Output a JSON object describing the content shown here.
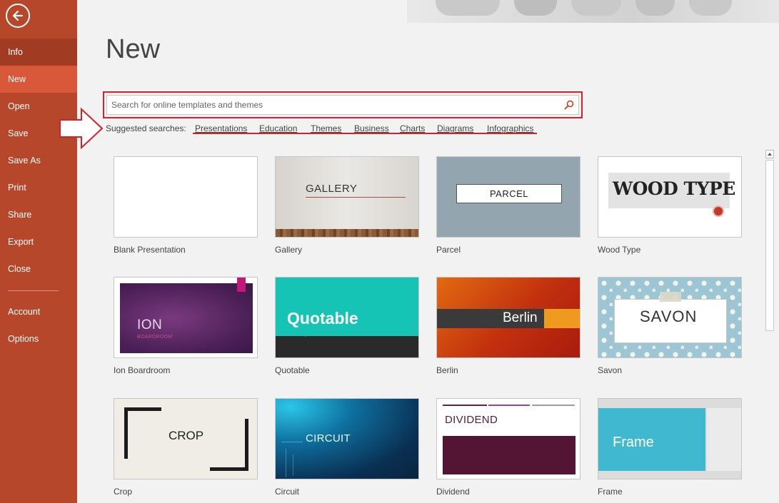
{
  "sidebar": {
    "back_icon": "arrow-left-icon",
    "items": [
      {
        "label": "Info"
      },
      {
        "label": "New"
      },
      {
        "label": "Open"
      },
      {
        "label": "Save"
      },
      {
        "label": "Save As"
      },
      {
        "label": "Print"
      },
      {
        "label": "Share"
      },
      {
        "label": "Export"
      },
      {
        "label": "Close"
      },
      {
        "label": "Account"
      },
      {
        "label": "Options"
      }
    ],
    "active": "New",
    "colors": {
      "bg": "#b7472a",
      "active": "#d9583a",
      "info": "#a13b22"
    }
  },
  "main": {
    "title": "New",
    "search": {
      "placeholder": "Search for online templates and themes",
      "value": "",
      "icon": "search-icon"
    },
    "suggested": {
      "label": "Suggested searches:",
      "links": [
        "Presentations",
        "Education",
        "Themes",
        "Business",
        "Charts",
        "Diagrams",
        "Infographics"
      ]
    },
    "templates": [
      {
        "name": "Blank Presentation",
        "thumb_text": ""
      },
      {
        "name": "Gallery",
        "thumb_text": "GALLERY"
      },
      {
        "name": "Parcel",
        "thumb_text": "PARCEL"
      },
      {
        "name": "Wood Type",
        "thumb_text": "WOOD TYPE"
      },
      {
        "name": "Ion Boardroom",
        "thumb_text": "ION",
        "thumb_sub": "BOARDROOM"
      },
      {
        "name": "Quotable",
        "thumb_text": "Quotable"
      },
      {
        "name": "Berlin",
        "thumb_text": "Berlin"
      },
      {
        "name": "Savon",
        "thumb_text": "SAVON"
      },
      {
        "name": "Crop",
        "thumb_text": "CROP"
      },
      {
        "name": "Circuit",
        "thumb_text": "CIRCUIT"
      },
      {
        "name": "Dividend",
        "thumb_text": "DIVIDEND"
      },
      {
        "name": "Frame",
        "thumb_text": "Frame"
      }
    ]
  },
  "annotation_color": "#d6212b"
}
